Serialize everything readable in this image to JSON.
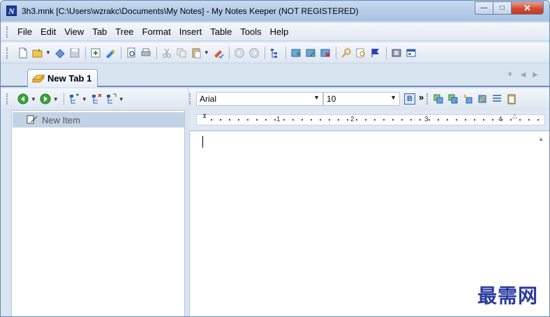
{
  "window": {
    "title": "3h3.mnk [C:\\Users\\wzrakc\\Documents\\My Notes] - My Notes Keeper (NOT REGISTERED)",
    "app_icon_letter": "N",
    "minimize_symbol": "—",
    "maximize_symbol": "□",
    "close_symbol": "✕"
  },
  "menubar": {
    "items": [
      "File",
      "Edit",
      "View",
      "Tab",
      "Tree",
      "Format",
      "Insert",
      "Table",
      "Tools",
      "Help"
    ]
  },
  "tabs": {
    "items": [
      {
        "label": "New Tab 1",
        "active": true
      }
    ],
    "nav_down": "▼",
    "nav_left": "◀",
    "nav_right": "▶"
  },
  "format_bar": {
    "font_value": "Arial",
    "size_value": "10",
    "bold_label": "B",
    "more_label": "»"
  },
  "tree": {
    "items": [
      {
        "label": "New Item",
        "selected": true
      }
    ]
  },
  "ruler": {
    "numbers": [
      "1",
      "2",
      "3",
      "4"
    ]
  },
  "watermark": {
    "text": "最需网"
  },
  "colors": {
    "window_bg": "#d9e4f1",
    "selection": "#c3d3e6",
    "close_button": "#d24a33",
    "tab_underline": "#6d8fc0"
  }
}
